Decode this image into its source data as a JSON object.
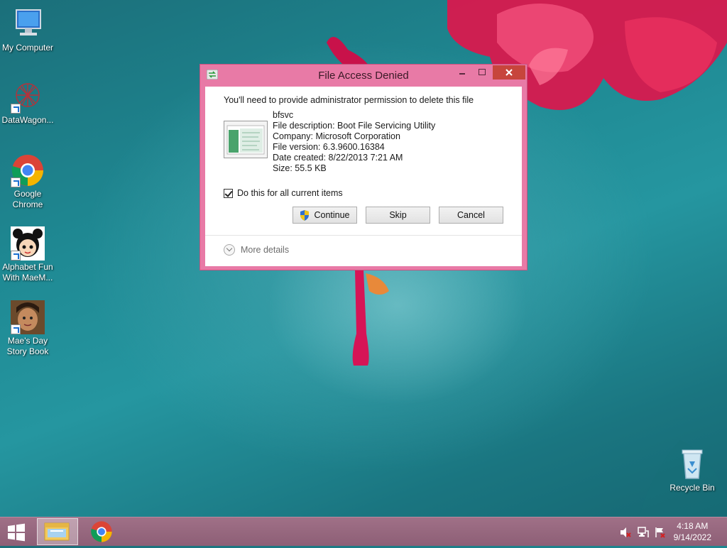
{
  "desktop": {
    "icons": [
      {
        "label": "My Computer"
      },
      {
        "label": "DataWagon..."
      },
      {
        "label": "Google Chrome"
      },
      {
        "label": "Alphabet Fun With MaeM..."
      },
      {
        "label": "Mae's Day Story Book"
      },
      {
        "label": "Recycle Bin"
      }
    ]
  },
  "dialog": {
    "title": "File Access Denied",
    "message": "You'll need to provide administrator permission to delete this file",
    "file": {
      "name": "bfsvc",
      "description": "File description: Boot File Servicing Utility",
      "company": "Company: Microsoft Corporation",
      "version": "File version: 6.3.9600.16384",
      "date_created": "Date created: 8/22/2013 7:21 AM",
      "size": "Size: 55.5 KB"
    },
    "checkbox_label": "Do this for all current items",
    "checkbox_checked": true,
    "buttons": {
      "continue": "Continue",
      "skip": "Skip",
      "cancel": "Cancel"
    },
    "more_details": "More details",
    "theme_color": "#e87aa6"
  },
  "taskbar": {
    "clock": {
      "time": "4:18 AM",
      "date": "9/14/2022"
    },
    "icons": [
      "windows-start-icon",
      "file-explorer-icon",
      "chrome-icon"
    ],
    "tray_icons": [
      "speaker-muted-icon",
      "network-icon",
      "action-center-flag-icon"
    ]
  }
}
